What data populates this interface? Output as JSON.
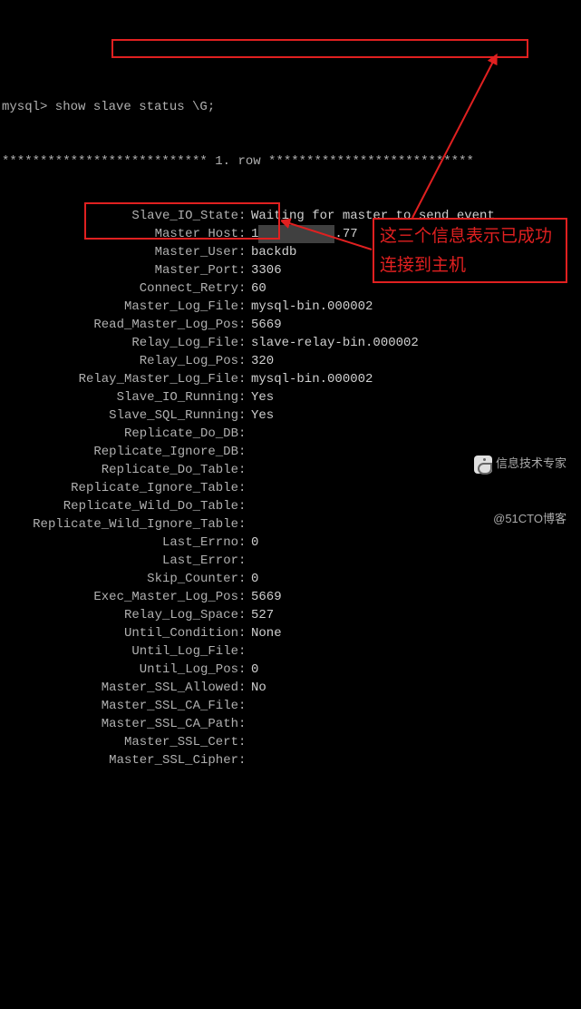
{
  "prompt": "mysql> show slave status \\G;",
  "separator": "*************************** 1. row ***************************",
  "highlight_keys": [
    "Slave_IO_State",
    "Slave_IO_Running",
    "Slave_SQL_Running"
  ],
  "callout_text": "这三个信息表示已成功连接到主机",
  "watermark": {
    "line1": "信息技术专家",
    "line2": "@51CTO博客"
  },
  "rows": [
    {
      "label": "Slave_IO_State",
      "value": "Waiting for master to send event"
    },
    {
      "label": "Master_Host",
      "value": "1",
      "redacted_tail": "██.██.█.77",
      "tail_plain": ".77"
    },
    {
      "label": "Master_User",
      "value": "backdb"
    },
    {
      "label": "Master_Port",
      "value": "3306"
    },
    {
      "label": "Connect_Retry",
      "value": "60"
    },
    {
      "label": "Master_Log_File",
      "value": "mysql-bin.000002"
    },
    {
      "label": "Read_Master_Log_Pos",
      "value": "5669"
    },
    {
      "label": "Relay_Log_File",
      "value": "slave-relay-bin.000002"
    },
    {
      "label": "Relay_Log_Pos",
      "value": "320"
    },
    {
      "label": "Relay_Master_Log_File",
      "value": "mysql-bin.000002"
    },
    {
      "label": "Slave_IO_Running",
      "value": "Yes"
    },
    {
      "label": "Slave_SQL_Running",
      "value": "Yes"
    },
    {
      "label": "Replicate_Do_DB",
      "value": ""
    },
    {
      "label": "Replicate_Ignore_DB",
      "value": ""
    },
    {
      "label": "Replicate_Do_Table",
      "value": ""
    },
    {
      "label": "Replicate_Ignore_Table",
      "value": ""
    },
    {
      "label": "Replicate_Wild_Do_Table",
      "value": ""
    },
    {
      "label": "Replicate_Wild_Ignore_Table",
      "value": ""
    },
    {
      "label": "Last_Errno",
      "value": "0"
    },
    {
      "label": "Last_Error",
      "value": ""
    },
    {
      "label": "Skip_Counter",
      "value": "0"
    },
    {
      "label": "Exec_Master_Log_Pos",
      "value": "5669"
    },
    {
      "label": "Relay_Log_Space",
      "value": "527"
    },
    {
      "label": "Until_Condition",
      "value": "None"
    },
    {
      "label": "Until_Log_File",
      "value": ""
    },
    {
      "label": "Until_Log_Pos",
      "value": "0"
    },
    {
      "label": "Master_SSL_Allowed",
      "value": "No"
    },
    {
      "label": "Master_SSL_CA_File",
      "value": ""
    },
    {
      "label": "Master_SSL_CA_Path",
      "value": ""
    },
    {
      "label": "Master_SSL_Cert",
      "value": ""
    },
    {
      "label": "Master_SSL_Cipher",
      "value": ""
    }
  ]
}
